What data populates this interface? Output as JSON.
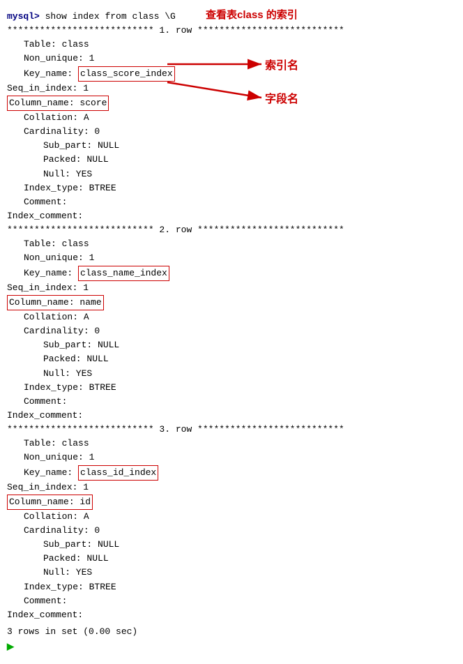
{
  "terminal": {
    "prompt": "mysql>",
    "command": "show index from class \\G",
    "annotation_top": "查看表class 的索引",
    "annotation_index_name": "索引名",
    "annotation_field_name": "字段名",
    "rows": [
      {
        "row_num": "1",
        "table": "class",
        "non_unique": "1",
        "key_name": "class_score_index",
        "seq_in_index": "1",
        "column_name": "score",
        "collation": "A",
        "cardinality": "0",
        "sub_part": "NULL",
        "packed": "NULL",
        "null_val": "YES",
        "index_type": "BTREE",
        "comment": "",
        "index_comment": ""
      },
      {
        "row_num": "2",
        "table": "class",
        "non_unique": "1",
        "key_name": "class_name_index",
        "seq_in_index": "1",
        "column_name": "name",
        "collation": "A",
        "cardinality": "0",
        "sub_part": "NULL",
        "packed": "NULL",
        "null_val": "YES",
        "index_type": "BTREE",
        "comment": "",
        "index_comment": ""
      },
      {
        "row_num": "3",
        "table": "class",
        "non_unique": "1",
        "key_name": "class_id_index",
        "seq_in_index": "1",
        "column_name": "id",
        "collation": "A",
        "cardinality": "0",
        "sub_part": "NULL",
        "packed": "NULL",
        "null_val": "YES",
        "index_type": "BTREE",
        "comment": "",
        "index_comment": ""
      }
    ],
    "footer": "3 rows in set (0.00 sec)"
  }
}
